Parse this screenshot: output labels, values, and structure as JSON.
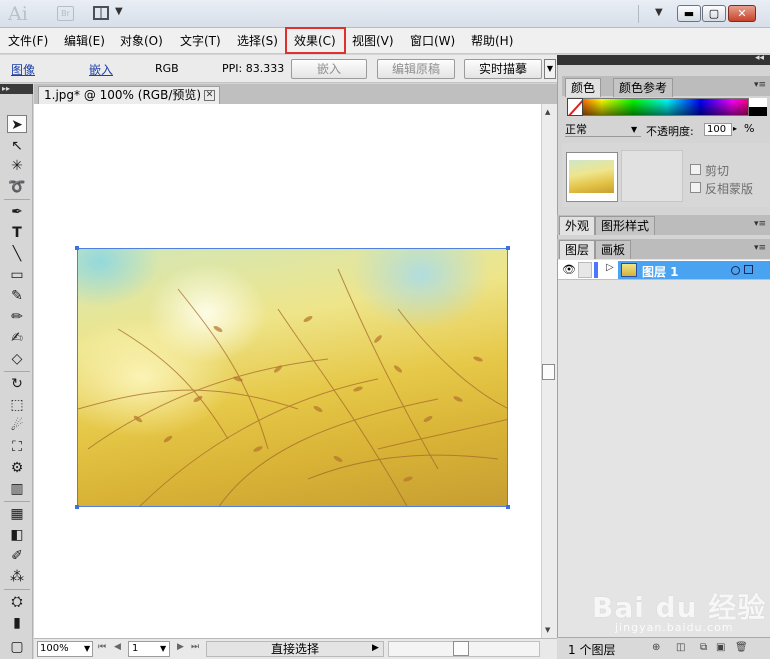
{
  "app": {
    "logo": "Ai",
    "bridge": "Br"
  },
  "menu": {
    "items": [
      "文件(F)",
      "编辑(E)",
      "对象(O)",
      "文字(T)",
      "选择(S)",
      "效果(C)",
      "视图(V)",
      "窗口(W)",
      "帮助(H)"
    ],
    "highlighted": "效果(C)",
    "highlight_color": "#e0302b"
  },
  "control_bar": {
    "object_type": "图像",
    "embed_link": "嵌入",
    "color_mode": "RGB",
    "ppi": "PPI: 83.333",
    "embed_button": "嵌入",
    "edit_original_button": "编辑原稿",
    "live_trace_button": "实时描摹"
  },
  "document": {
    "tab_title": "1.jpg* @ 100% (RGB/预览)"
  },
  "status_bar": {
    "zoom": "100%",
    "page": "1",
    "current_tool": "直接选择"
  },
  "panels": {
    "color_tabs": [
      "颜色",
      "颜色参考"
    ],
    "blend_mode": "正常",
    "opacity_label": "不透明度:",
    "opacity_value": "100",
    "opacity_unit": "%",
    "clip_label": "剪切",
    "invert_mask_label": "反相蒙版",
    "appearance_tabs": [
      "外观",
      "图形样式"
    ],
    "layer_tabs": [
      "图层",
      "画板"
    ],
    "layer_name": "图层 1",
    "layer_count": "1 个图层",
    "accent_color": "#4aa3f0"
  },
  "watermark": {
    "text": "Bai du 经验",
    "sub": "jingyan.baidu.com"
  }
}
